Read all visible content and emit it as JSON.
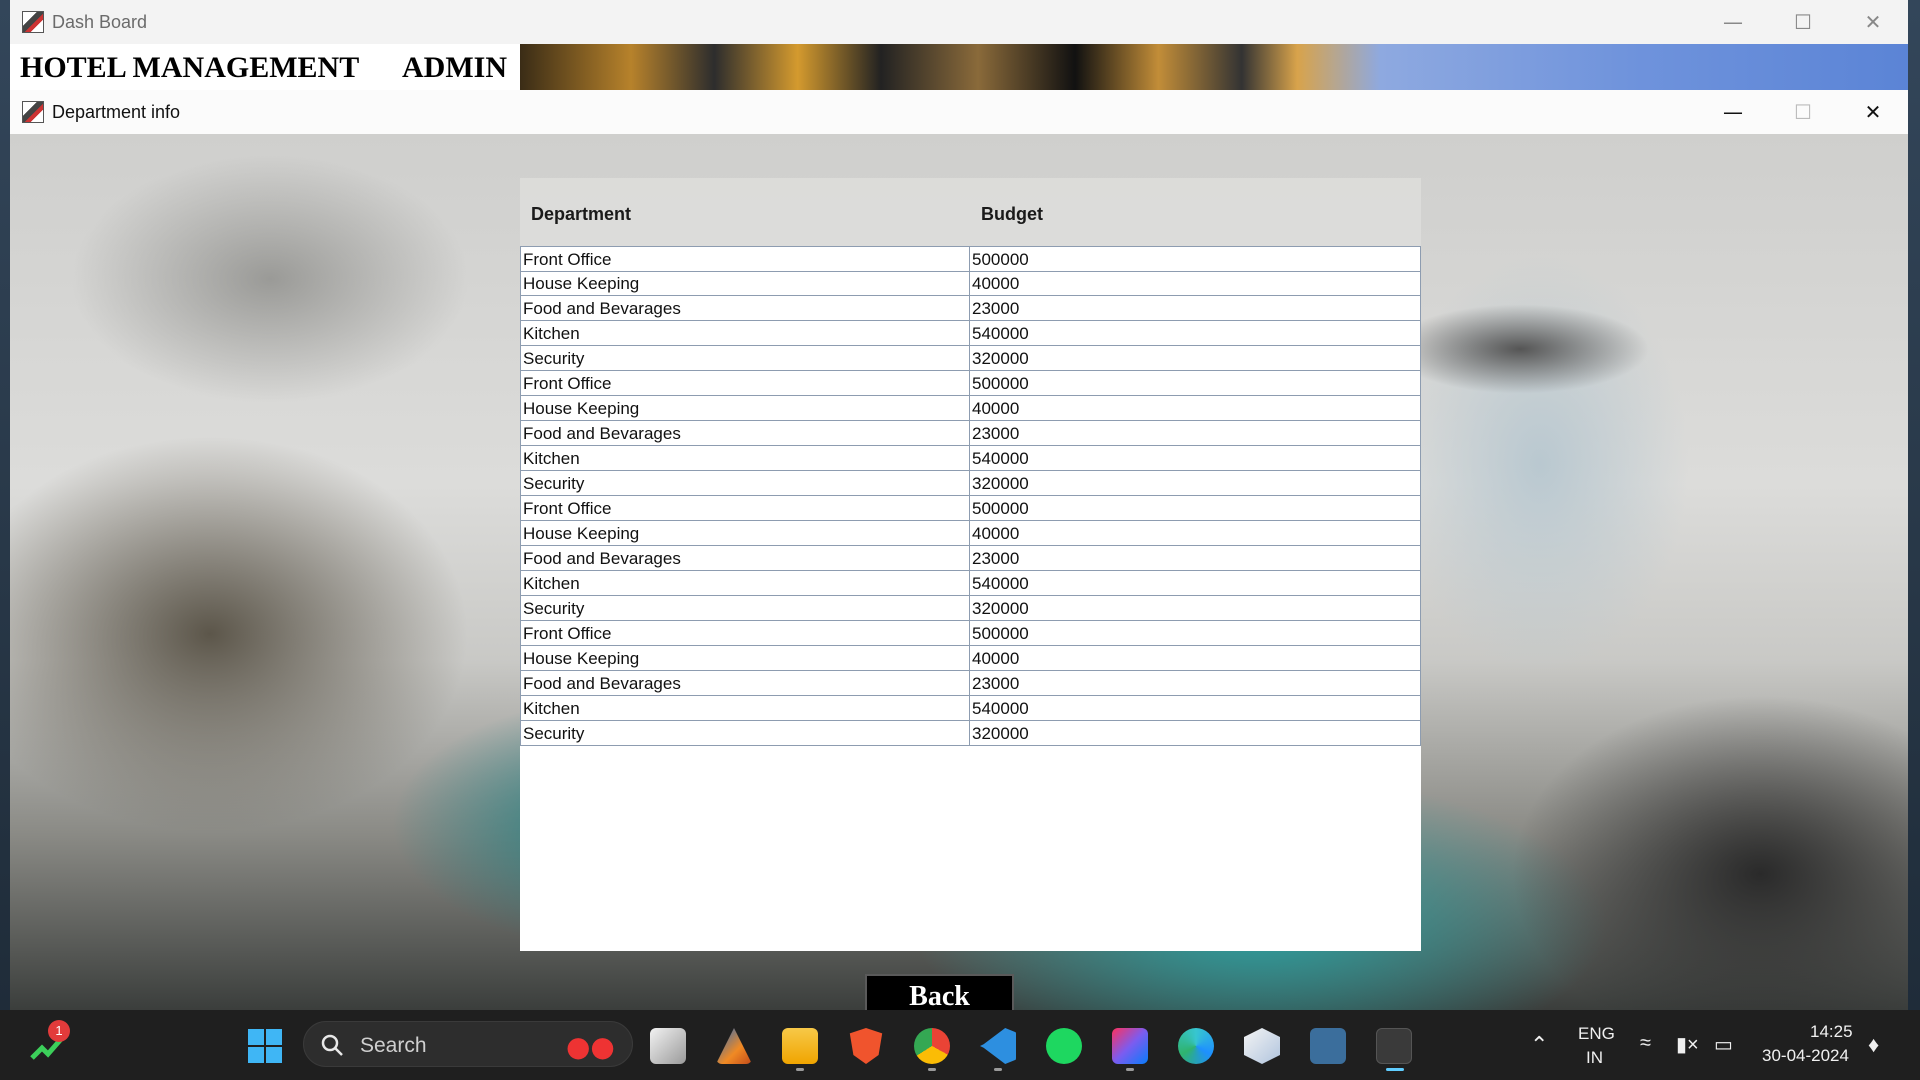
{
  "dashboard_window": {
    "title": "Dash Board",
    "menu": {
      "hotel_management": "HOTEL MANAGEMENT",
      "admin": "ADMIN"
    }
  },
  "department_window": {
    "title": "Department info",
    "columns": {
      "department": "Department",
      "budget": "Budget"
    },
    "rows": [
      {
        "department": "Front Office",
        "budget": "500000"
      },
      {
        "department": "House Keeping",
        "budget": "40000"
      },
      {
        "department": "Food and Bevarages",
        "budget": "23000"
      },
      {
        "department": "Kitchen",
        "budget": "540000"
      },
      {
        "department": "Security",
        "budget": "320000"
      },
      {
        "department": "Front Office",
        "budget": "500000"
      },
      {
        "department": "House Keeping",
        "budget": "40000"
      },
      {
        "department": "Food and Bevarages",
        "budget": "23000"
      },
      {
        "department": "Kitchen",
        "budget": "540000"
      },
      {
        "department": "Security",
        "budget": "320000"
      },
      {
        "department": "Front Office",
        "budget": "500000"
      },
      {
        "department": "House Keeping",
        "budget": "40000"
      },
      {
        "department": "Food and Bevarages",
        "budget": "23000"
      },
      {
        "department": "Kitchen",
        "budget": "540000"
      },
      {
        "department": "Security",
        "budget": "320000"
      },
      {
        "department": "Front Office",
        "budget": "500000"
      },
      {
        "department": "House Keeping",
        "budget": "40000"
      },
      {
        "department": "Food and Bevarages",
        "budget": "23000"
      },
      {
        "department": "Kitchen",
        "budget": "540000"
      },
      {
        "department": "Security",
        "budget": "320000"
      }
    ],
    "back_label": "Back"
  },
  "taskbar": {
    "notification_count": "1",
    "search_placeholder": "Search",
    "language": "ENG",
    "region": "IN",
    "time": "14:25",
    "date": "30-04-2024",
    "apps": [
      "stocks-widget-icon",
      "windows-start-icon",
      "task-view-icon",
      "matlab-icon",
      "file-explorer-icon",
      "brave-icon",
      "chrome-icon",
      "vscode-icon",
      "spotify-icon",
      "intellij-icon",
      "edge-icon",
      "virtualbox-icon",
      "mysql-workbench-icon",
      "java-app-icon"
    ]
  }
}
